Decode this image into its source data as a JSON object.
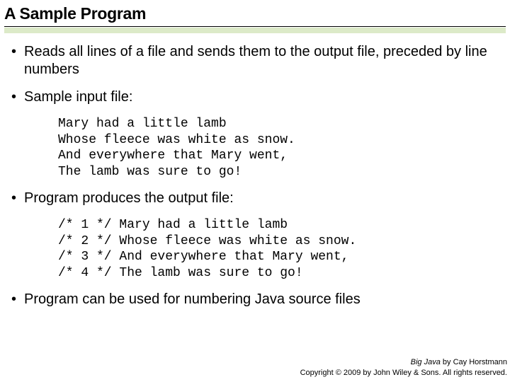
{
  "title": "A Sample Program",
  "bullets": {
    "b1": "Reads all lines of a file and sends them to the output file, preceded by line numbers",
    "b2": "Sample input file:",
    "b3": "Program produces the output file:",
    "b4": "Program can be used for numbering Java source files"
  },
  "code": {
    "input": "Mary had a little lamb\nWhose fleece was white as snow.\nAnd everywhere that Mary went,\nThe lamb was sure to go!",
    "output": "/* 1 */ Mary had a little lamb\n/* 2 */ Whose fleece was white as snow.\n/* 3 */ And everywhere that Mary went,\n/* 4 */ The lamb was sure to go!"
  },
  "footer": {
    "line1_book": "Big Java",
    "line1_rest": " by Cay Horstmann",
    "line2": "Copyright © 2009 by John Wiley & Sons.  All rights reserved."
  }
}
